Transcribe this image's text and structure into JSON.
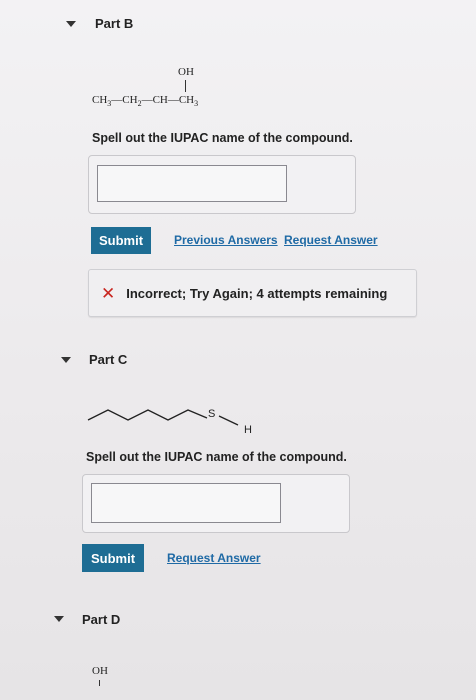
{
  "part_b": {
    "title": "Part B",
    "structure": {
      "oh": "OH",
      "chain": "CH3—CH2—CH—CH3"
    },
    "prompt": "Spell out the IUPAC name of the compound.",
    "answer_value": "",
    "submit_label": "Submit",
    "previous_answers_label": "Previous Answers",
    "request_answer_label": "Request Answer",
    "feedback": {
      "icon": "x-icon",
      "text": "Incorrect; Try Again; 4 attempts remaining",
      "color": "#c8251f"
    }
  },
  "part_c": {
    "title": "Part C",
    "structure": {
      "s_label": "S",
      "h_label": "H"
    },
    "prompt": "Spell out the IUPAC name of the compound.",
    "answer_value": "",
    "submit_label": "Submit",
    "request_answer_label": "Request Answer"
  },
  "part_d": {
    "title": "Part D",
    "structure": {
      "oh": "OH"
    }
  },
  "colors": {
    "submit_bg": "#1e6d94",
    "link": "#1f6aa5",
    "error": "#c8251f"
  }
}
